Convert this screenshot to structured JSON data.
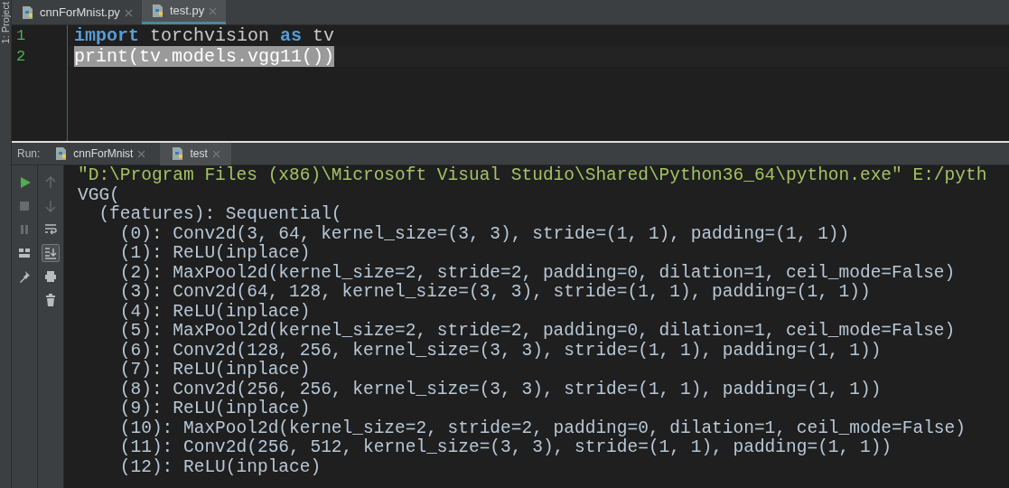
{
  "side_strip": {
    "label": "1: Project"
  },
  "editor_tabs": [
    {
      "label": "cnnForMnist.py",
      "selected": false
    },
    {
      "label": "test.py",
      "selected": true
    }
  ],
  "editor": {
    "lines": [
      {
        "number": "1",
        "selected": false,
        "tokens": [
          {
            "text": "import",
            "kind": "keyword"
          },
          {
            "text": " torchvision ",
            "kind": "plain"
          },
          {
            "text": "as",
            "kind": "keyword"
          },
          {
            "text": " tv",
            "kind": "plain"
          }
        ]
      },
      {
        "number": "2",
        "selected": true,
        "tokens": [
          {
            "text": "print(tv.models.vgg11())",
            "kind": "plain"
          }
        ]
      }
    ]
  },
  "run_panel": {
    "label": "Run:",
    "tabs": [
      {
        "label": "cnnForMnist",
        "selected": false
      },
      {
        "label": "test",
        "selected": true
      }
    ],
    "toolbar": [
      {
        "kind": "run"
      },
      {
        "kind": "stop"
      },
      {
        "kind": "pause"
      },
      {
        "kind": "layout"
      },
      {
        "kind": "pin"
      }
    ],
    "toolbar_2": [
      {
        "kind": "up",
        "active": false
      },
      {
        "kind": "down",
        "active": false
      },
      {
        "kind": "wrap",
        "active": false
      },
      {
        "kind": "scroll-end",
        "active": true
      },
      {
        "kind": "print",
        "active": false
      },
      {
        "kind": "trash",
        "active": false
      }
    ],
    "console": [
      {
        "kind": "command",
        "text": "\"D:\\Program Files (x86)\\Microsoft Visual Studio\\Shared\\Python36_64\\python.exe\" E:/pyth"
      },
      {
        "kind": "output",
        "text": "VGG("
      },
      {
        "kind": "output",
        "text": "  (features): Sequential("
      },
      {
        "kind": "output",
        "text": "    (0): Conv2d(3, 64, kernel_size=(3, 3), stride=(1, 1), padding=(1, 1))"
      },
      {
        "kind": "output",
        "text": "    (1): ReLU(inplace)"
      },
      {
        "kind": "output",
        "text": "    (2): MaxPool2d(kernel_size=2, stride=2, padding=0, dilation=1, ceil_mode=False)"
      },
      {
        "kind": "output",
        "text": "    (3): Conv2d(64, 128, kernel_size=(3, 3), stride=(1, 1), padding=(1, 1))"
      },
      {
        "kind": "output",
        "text": "    (4): ReLU(inplace)"
      },
      {
        "kind": "output",
        "text": "    (5): MaxPool2d(kernel_size=2, stride=2, padding=0, dilation=1, ceil_mode=False)"
      },
      {
        "kind": "output",
        "text": "    (6): Conv2d(128, 256, kernel_size=(3, 3), stride=(1, 1), padding=(1, 1))"
      },
      {
        "kind": "output",
        "text": "    (7): ReLU(inplace)"
      },
      {
        "kind": "output",
        "text": "    (8): Conv2d(256, 256, kernel_size=(3, 3), stride=(1, 1), padding=(1, 1))"
      },
      {
        "kind": "output",
        "text": "    (9): ReLU(inplace)"
      },
      {
        "kind": "output",
        "text": "    (10): MaxPool2d(kernel_size=2, stride=2, padding=0, dilation=1, ceil_mode=False)"
      },
      {
        "kind": "output",
        "text": "    (11): Conv2d(256, 512, kernel_size=(3, 3), stride=(1, 1), padding=(1, 1))"
      },
      {
        "kind": "output",
        "text": "    (12): ReLU(inplace)"
      }
    ]
  }
}
